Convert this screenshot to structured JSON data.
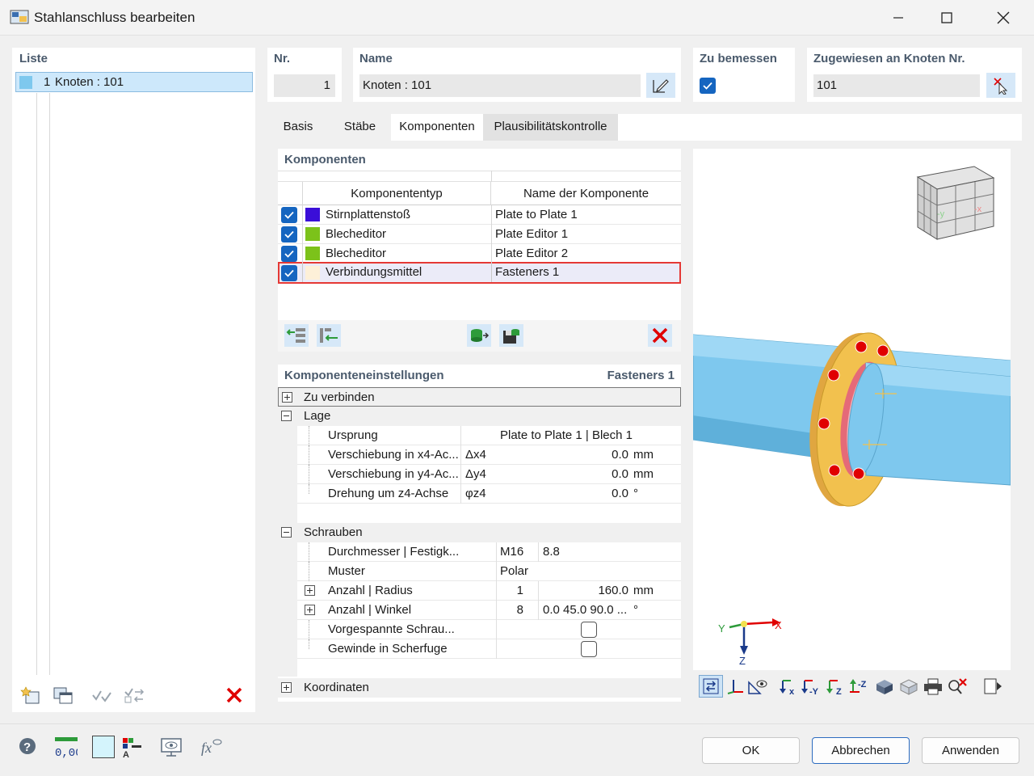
{
  "window": {
    "title": "Stahlanschluss bearbeiten"
  },
  "list": {
    "header": "Liste",
    "items": [
      {
        "num": "1",
        "label": "Knoten : 101"
      }
    ]
  },
  "header_fields": {
    "nr_label": "Nr.",
    "nr_value": "1",
    "name_label": "Name",
    "name_value": "Knoten : 101",
    "design_label": "Zu bemessen",
    "assigned_label": "Zugewiesen an Knoten Nr.",
    "assigned_value": "101"
  },
  "tabs": [
    "Basis",
    "Stäbe",
    "Komponenten",
    "Plausibilitätskontrolle"
  ],
  "components": {
    "header": "Komponenten",
    "col_type": "Komponententyp",
    "col_name": "Name der Komponente",
    "rows": [
      {
        "type": "Stirnplattenstoß",
        "name": "Plate to Plate 1",
        "color": "#3a0ed8"
      },
      {
        "type": "Blecheditor",
        "name": "Plate Editor 1",
        "color": "#7cc21a"
      },
      {
        "type": "Blecheditor",
        "name": "Plate Editor 2",
        "color": "#7cc21a"
      },
      {
        "type": "Verbindungsmittel",
        "name": "Fasteners 1",
        "color": "#fdf0d8"
      }
    ]
  },
  "settings": {
    "header": "Komponenteneinstellungen",
    "selected": "Fasteners 1",
    "zu_verbinden": "Zu verbinden",
    "lage": "Lage",
    "ursprung": "Ursprung",
    "ursprung_value": "Plate to Plate 1 | Blech 1",
    "shift_x": "Verschiebung in x4-Ac...",
    "shift_x_sym": "Δx4",
    "shift_x_val": "0.0",
    "shift_y": "Verschiebung in y4-Ac...",
    "shift_y_sym": "Δy4",
    "shift_y_val": "0.0",
    "rot": "Drehung um z4-Achse",
    "rot_sym": "φz4",
    "rot_val": "0.0",
    "unit_mm": "mm",
    "unit_deg": "°",
    "schrauben": "Schrauben",
    "durchmesser": "Durchmesser | Festigk...",
    "durchmesser_v1": "M16",
    "durchmesser_v2": "8.8",
    "muster": "Muster",
    "muster_val": "Polar",
    "anzahl_radius": "Anzahl | Radius",
    "anzahl_radius_v1": "1",
    "anzahl_radius_v2": "160.0",
    "anzahl_winkel": "Anzahl | Winkel",
    "anzahl_winkel_v1": "8",
    "anzahl_winkel_v2": "0.0 45.0 90.0 ...",
    "vorgespannt": "Vorgespannte Schrau...",
    "gewinde": "Gewinde in Scherfuge",
    "koordinaten": "Koordinaten"
  },
  "axes": {
    "x": "X",
    "y": "Y",
    "z": "Z"
  },
  "viewcube": {
    "y": "-y",
    "x": "-x"
  },
  "buttons": {
    "ok": "OK",
    "cancel": "Abbrechen",
    "apply": "Anwenden"
  },
  "bottom_tools": {
    "units": "0,00"
  },
  "colors": {
    "accent": "#1565c0",
    "highlight": "#e53935",
    "pipe": "#7ec8ee",
    "plate": "#f2c14e"
  }
}
